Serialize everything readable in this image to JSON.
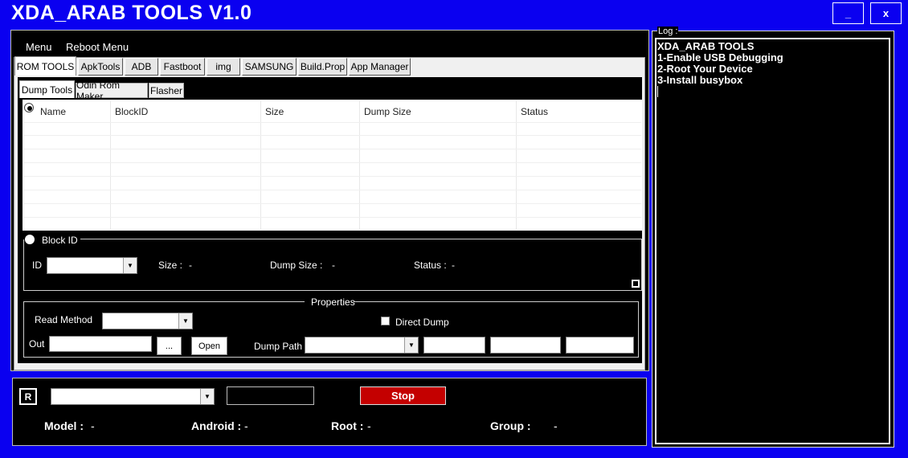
{
  "window": {
    "title": "XDA_ARAB TOOLS  V1.0",
    "minimize_label": "_",
    "close_label": "x"
  },
  "menubar": {
    "menu": "Menu",
    "reboot_menu": "Reboot Menu"
  },
  "tabs": [
    "ROM TOOLS",
    "ApkTools",
    "ADB",
    "Fastboot",
    "img",
    "SAMSUNG",
    "Build.Prop",
    "App Manager"
  ],
  "subtabs": [
    "Dump Tools",
    "Odin Rom Maker",
    "Flasher"
  ],
  "table": {
    "columns": [
      "Name",
      "BlockID",
      "Size",
      "Dump Size",
      "Status"
    ],
    "rows": []
  },
  "block_id": {
    "legend": "Block ID",
    "id_label": "ID",
    "size_label": "Size :",
    "size_value": "-",
    "dump_size_label": "Dump Size :",
    "dump_size_value": "-",
    "status_label": "Status :",
    "status_value": "-"
  },
  "properties": {
    "legend": "Properties",
    "read_method_label": "Read Method",
    "direct_dump_label": "Direct Dump",
    "out_label": "Out",
    "browse_label": "...",
    "open_label": "Open",
    "dump_path_label": "Dump Path"
  },
  "bottom": {
    "r_button": "R",
    "stop_label": "Stop",
    "model_label": "Model :",
    "model_value": "-",
    "android_label": "Android :",
    "android_value": "-",
    "root_label": "Root :",
    "root_value": "-",
    "group_label": "Group :",
    "group_value": "-"
  },
  "log": {
    "legend": "Log :",
    "lines": [
      "XDA_ARAB TOOLS",
      "1-Enable USB Debugging",
      "2-Root Your Device",
      "3-Install busybox"
    ]
  },
  "colors": {
    "window_bg": "#0a00f0",
    "panel_bg": "#000000",
    "stop_button": "#c40000"
  }
}
